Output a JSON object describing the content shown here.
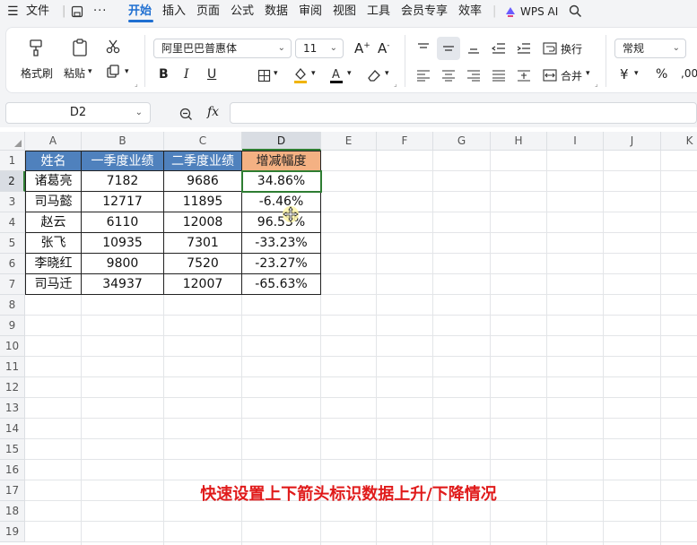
{
  "menu": {
    "hamburger_icon": "menu-icon",
    "file": "文件",
    "tabs": [
      "开始",
      "插入",
      "页面",
      "公式",
      "数据",
      "审阅",
      "视图",
      "工具",
      "会员专享",
      "效率"
    ],
    "active_tab": "开始",
    "wps_ai": "WPS AI"
  },
  "ribbon": {
    "format_painter": "格式刷",
    "paste": "粘贴",
    "font_name": "阿里巴巴普惠体",
    "font_size": "11",
    "wrap": "换行",
    "merge": "合并",
    "number_format": "常规",
    "currency": "¥",
    "percent": "%"
  },
  "formula_bar": {
    "name_box": "D2",
    "fx": "fx",
    "content": ""
  },
  "columns": [
    "A",
    "B",
    "C",
    "D",
    "E",
    "F",
    "G",
    "H",
    "I",
    "J",
    "K"
  ],
  "rows": [
    "1",
    "2",
    "3",
    "4",
    "5",
    "6",
    "7",
    "8",
    "9",
    "10",
    "11",
    "12",
    "13",
    "14",
    "15",
    "16",
    "17",
    "18",
    "19"
  ],
  "table": {
    "headers": [
      "姓名",
      "一季度业绩",
      "二季度业绩",
      "增减幅度"
    ],
    "rows": [
      [
        "诸葛亮",
        "7182",
        "9686",
        "34.86%"
      ],
      [
        "司马懿",
        "12717",
        "11895",
        "-6.46%"
      ],
      [
        "赵云",
        "6110",
        "12008",
        "96.53%"
      ],
      [
        "张飞",
        "10935",
        "7301",
        "-33.23%"
      ],
      [
        "李晓红",
        "9800",
        "7520",
        "-23.27%"
      ],
      [
        "司马迁",
        "34937",
        "12007",
        "-65.63%"
      ]
    ]
  },
  "caption": "快速设置上下箭头标识数据上升/下降情况",
  "colors": {
    "accent": "#1f6fd1",
    "header_blue": "#4f81bd",
    "header_orange": "#f4b183",
    "selection": "#2e7d32",
    "caption": "#e01b1b"
  }
}
